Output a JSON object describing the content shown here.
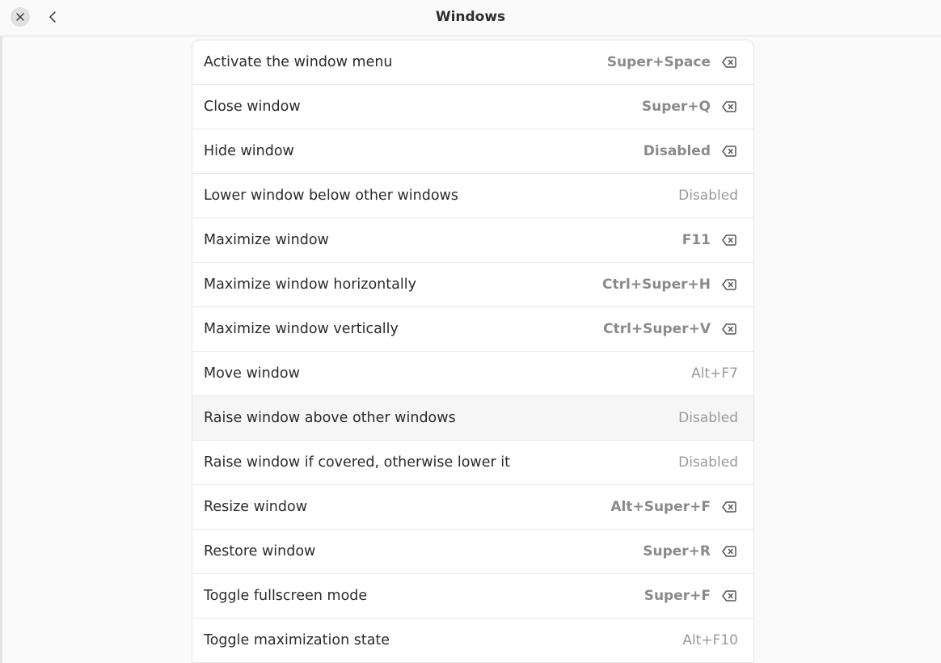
{
  "header": {
    "title": "Windows",
    "close_icon": "close-icon",
    "back_icon": "go-back-icon"
  },
  "shortcuts": [
    {
      "label": "Activate the window menu",
      "accelerator": "Super+Space",
      "custom": true
    },
    {
      "label": "Close window",
      "accelerator": "Super+Q",
      "custom": true
    },
    {
      "label": "Hide window",
      "accelerator": "Disabled",
      "custom": true
    },
    {
      "label": "Lower window below other windows",
      "accelerator": "Disabled",
      "custom": false
    },
    {
      "label": "Maximize window",
      "accelerator": "F11",
      "custom": true
    },
    {
      "label": "Maximize window horizontally",
      "accelerator": "Ctrl+Super+H",
      "custom": true
    },
    {
      "label": "Maximize window vertically",
      "accelerator": "Ctrl+Super+V",
      "custom": true
    },
    {
      "label": "Move window",
      "accelerator": "Alt+F7",
      "custom": false
    },
    {
      "label": "Raise window above other windows",
      "accelerator": "Disabled",
      "custom": false,
      "hovered": true
    },
    {
      "label": "Raise window if covered, otherwise lower it",
      "accelerator": "Disabled",
      "custom": false
    },
    {
      "label": "Resize window",
      "accelerator": "Alt+Super+F",
      "custom": true
    },
    {
      "label": "Restore window",
      "accelerator": "Super+R",
      "custom": true
    },
    {
      "label": "Toggle fullscreen mode",
      "accelerator": "Super+F",
      "custom": true
    },
    {
      "label": "Toggle maximization state",
      "accelerator": "Alt+F10",
      "custom": false
    }
  ],
  "icons": {
    "reset": "edit-clear-icon"
  },
  "colors": {
    "background": "#fafafa",
    "card": "#ffffff",
    "text": "#2b2b2b",
    "accelerator": "#9a9a9a"
  }
}
